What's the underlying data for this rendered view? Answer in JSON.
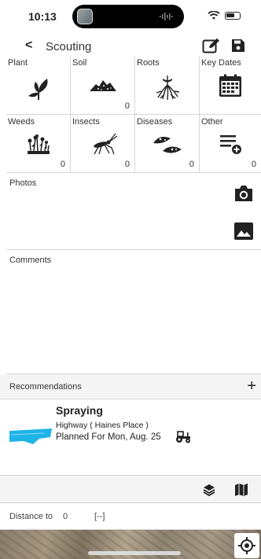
{
  "status": {
    "time": "10:13"
  },
  "nav": {
    "back_glyph": "<",
    "title": "Scouting",
    "edit_icon": "edit-icon",
    "save_icon": "save-icon"
  },
  "grid": {
    "row1": [
      {
        "label": "Plant",
        "icon": "plant-icon",
        "count": ""
      },
      {
        "label": "Soil",
        "icon": "soil-icon",
        "count": "0"
      },
      {
        "label": "Roots",
        "icon": "roots-icon",
        "count": ""
      },
      {
        "label": "Key Dates",
        "icon": "calendar-icon",
        "count": ""
      }
    ],
    "row2": [
      {
        "label": "Weeds",
        "icon": "weeds-icon",
        "count": "0"
      },
      {
        "label": "Insects",
        "icon": "insect-icon",
        "count": "0"
      },
      {
        "label": "Diseases",
        "icon": "disease-icon",
        "count": "0"
      },
      {
        "label": "Other",
        "icon": "other-list-icon",
        "count": "0"
      }
    ]
  },
  "photos": {
    "label": "Photos"
  },
  "comments": {
    "label": "Comments"
  },
  "recommendations": {
    "label": "Recommendations",
    "add_glyph": "+",
    "item": {
      "title": "Spraying",
      "location": "Highway ( Haines Place )",
      "planned": "Planned For Mon, Aug. 25"
    }
  },
  "distance": {
    "label": "Distance to",
    "value": "0",
    "selector": "[--]"
  },
  "colors": {
    "accent": "#1fb4e8",
    "icon": "#222222"
  }
}
